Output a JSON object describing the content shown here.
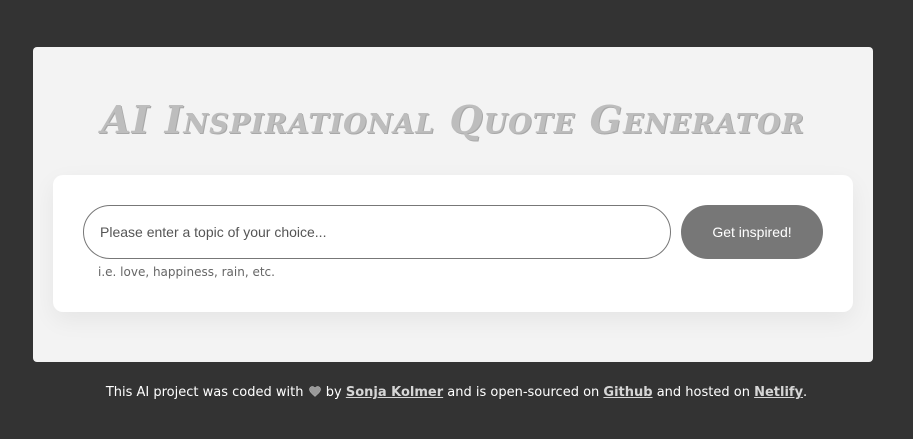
{
  "header": {
    "title": "AI Inspirational Quote Generator"
  },
  "form": {
    "input_placeholder": "Please enter a topic of your choice...",
    "input_value": "",
    "hint": "i.e. love, happiness, rain, etc.",
    "submit_label": "Get inspired!"
  },
  "footer": {
    "text_1": "This AI project was coded with",
    "heart_icon": "heart-icon",
    "text_2": "by",
    "author_link": "Sonja Kolmer",
    "text_3": "and is open-sourced on",
    "github_link": "Github",
    "text_4": "and hosted on",
    "netlify_link": "Netlify",
    "text_5": "."
  },
  "colors": {
    "background": "#333333",
    "card": "#f3f3f3",
    "button": "#777777"
  }
}
